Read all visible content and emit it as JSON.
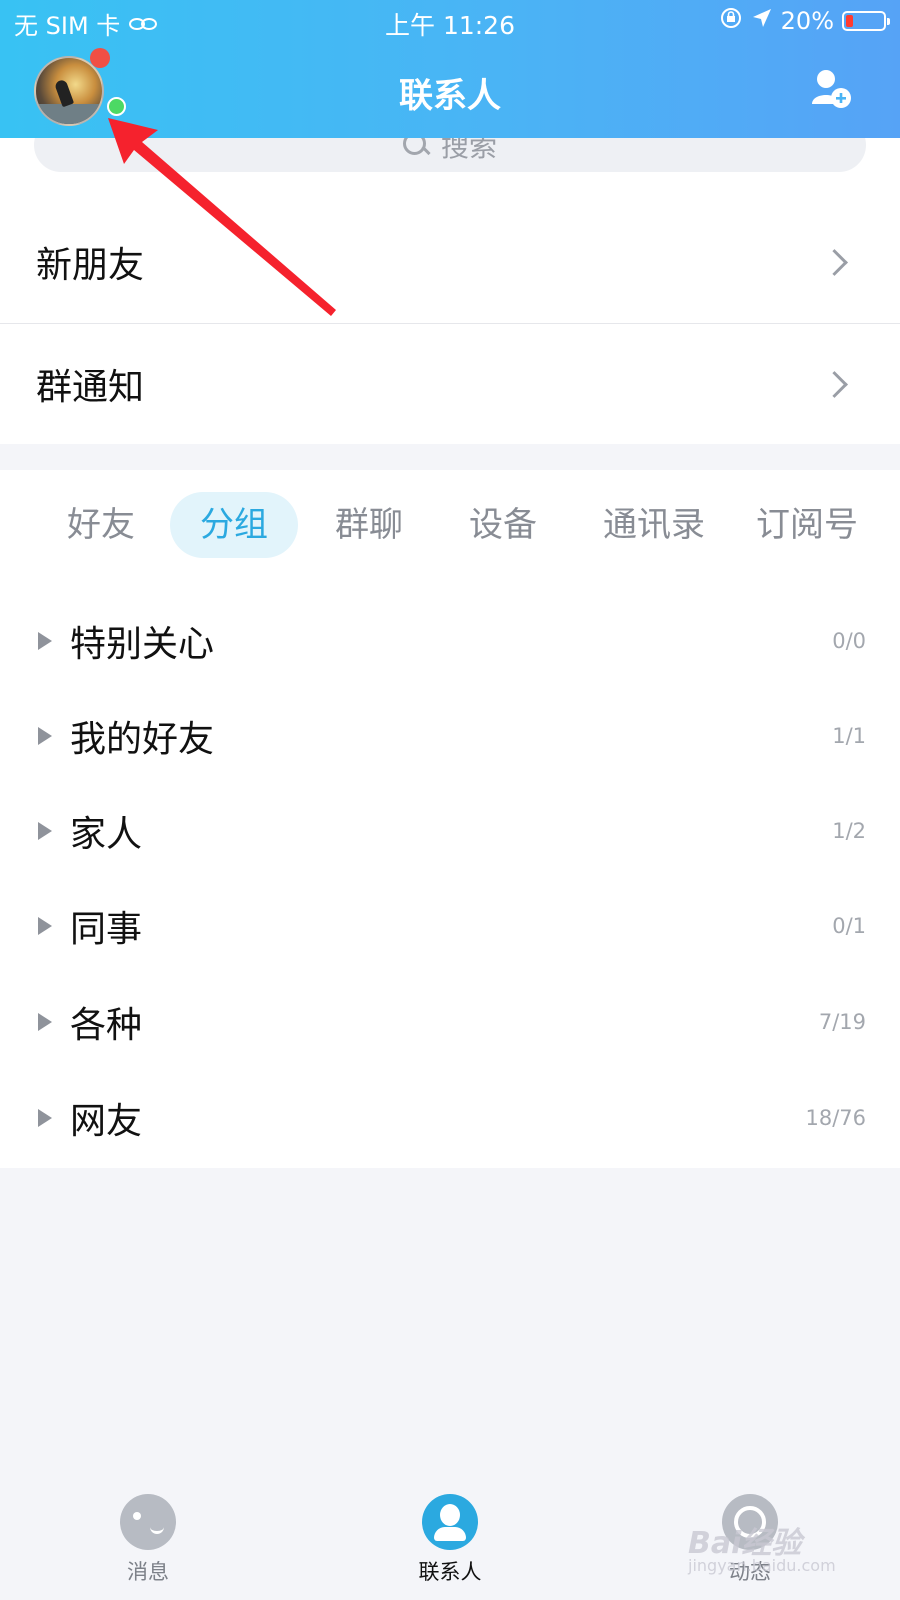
{
  "status_bar": {
    "carrier": "无 SIM 卡",
    "time": "上午 11:26",
    "battery": "20%",
    "battery_level": 0.2
  },
  "header": {
    "title": "联系人",
    "add_friend_icon": "add-person-icon"
  },
  "search": {
    "placeholder": "搜索"
  },
  "entries": {
    "new_friends": "新朋友",
    "group_notice": "群通知"
  },
  "tabs": [
    {
      "label": "好友"
    },
    {
      "label": "分组",
      "active": true
    },
    {
      "label": "群聊"
    },
    {
      "label": "设备"
    },
    {
      "label": "通讯录"
    },
    {
      "label": "订阅号"
    }
  ],
  "groups": [
    {
      "name": "特别关心",
      "count": "0/0"
    },
    {
      "name": "我的好友",
      "count": "1/1"
    },
    {
      "name": "家人",
      "count": "1/2"
    },
    {
      "name": "同事",
      "count": "0/1"
    },
    {
      "name": "各种",
      "count": "7/19"
    },
    {
      "name": "网友",
      "count": "18/76"
    }
  ],
  "tabbar": [
    {
      "label": "消息",
      "icon": "message-icon"
    },
    {
      "label": "联系人",
      "icon": "contacts-icon",
      "active": true
    },
    {
      "label": "动态",
      "icon": "feed-icon"
    }
  ],
  "watermark": {
    "brand": "Bai经验",
    "url": "jingyan.baidu.com"
  },
  "colors": {
    "accent": "#2ba9e0",
    "header_start": "#38c2f3",
    "header_end": "#56a3f6",
    "annotation_arrow": "#f5222d"
  }
}
